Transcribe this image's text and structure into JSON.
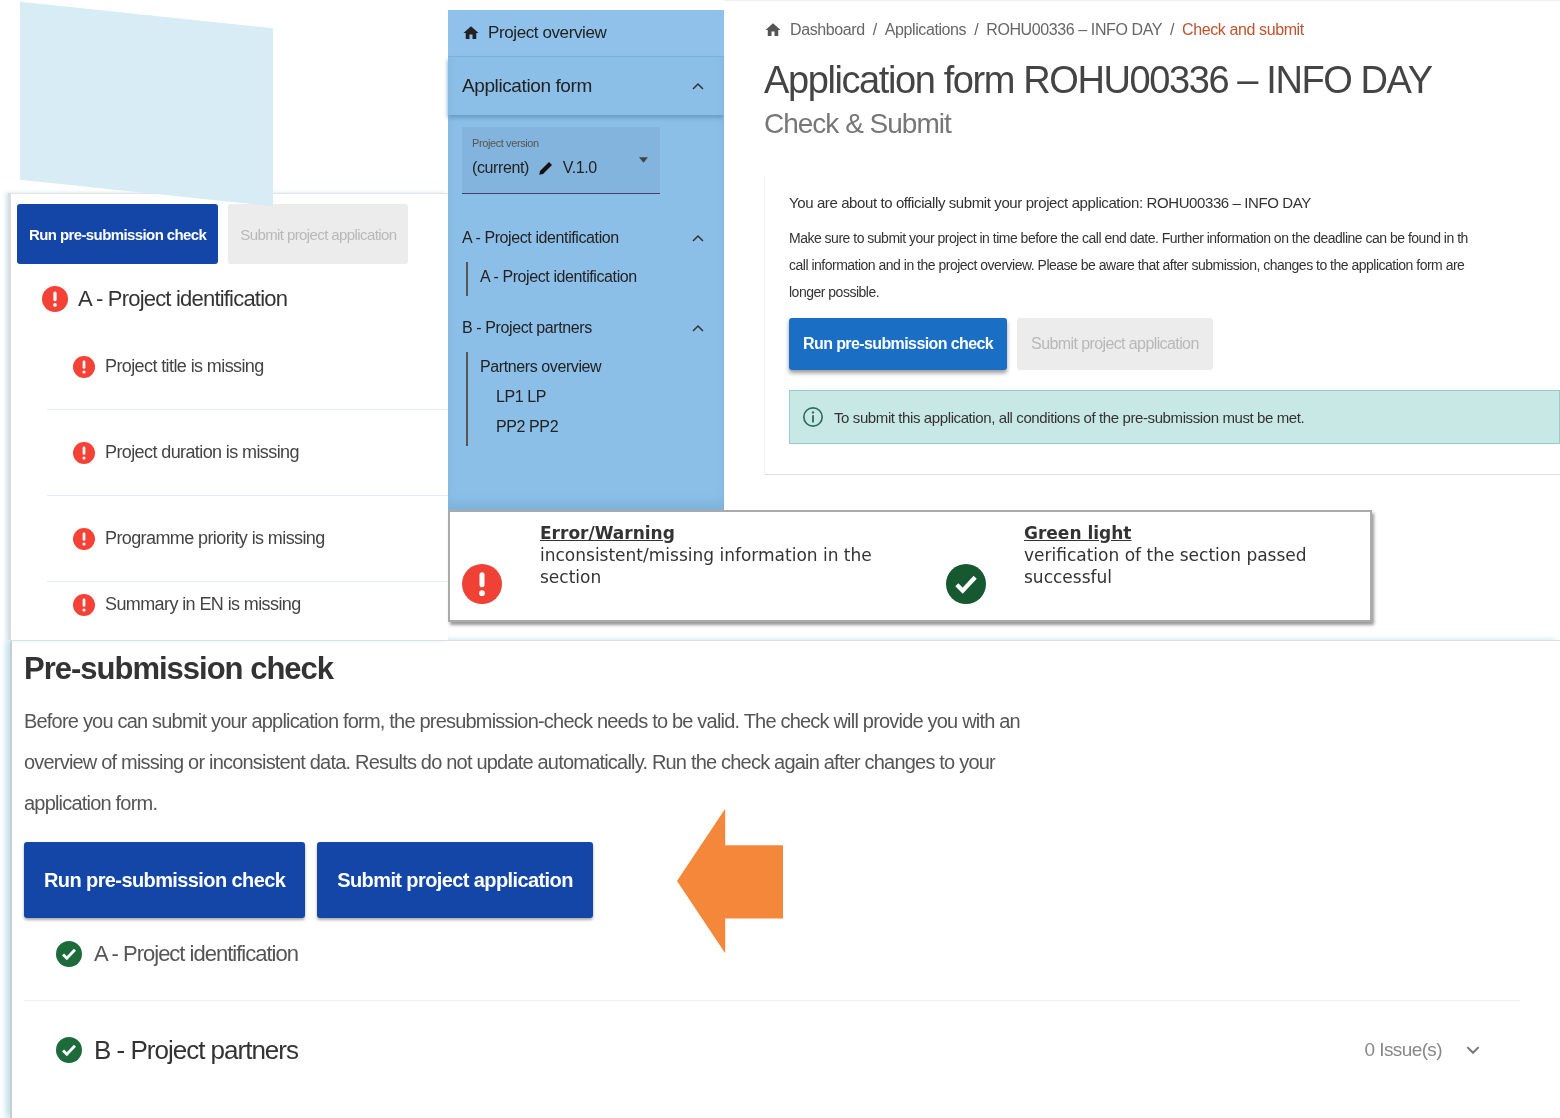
{
  "check_panel": {
    "buttons": [
      {
        "label": "Run pre-submission check",
        "enabled": true
      },
      {
        "label": "Submit project application",
        "enabled": false
      }
    ],
    "section": {
      "title": "A - Project identification",
      "kind": "error"
    },
    "issues": [
      {
        "text": "Project title is missing",
        "kind": "error"
      },
      {
        "text": "Project duration is missing",
        "kind": "error"
      },
      {
        "text": "Programme priority is missing",
        "kind": "error"
      },
      {
        "text": "Summary in EN is missing",
        "kind": "error"
      }
    ]
  },
  "sidebar": {
    "header": "Project overview",
    "application_form": {
      "label": "Application form",
      "expanded": true
    },
    "version": {
      "label": "Project version",
      "prefix": "(current)",
      "value": "V.1.0"
    },
    "groups": [
      {
        "label": "A - Project identification",
        "expanded": true,
        "children": [
          {
            "label": "A - Project identification"
          }
        ]
      },
      {
        "label": "B - Project partners",
        "expanded": true,
        "children": [
          {
            "label": "Partners overview",
            "children": [
              {
                "label": "LP1 LP"
              },
              {
                "label": "PP2 PP2"
              }
            ]
          }
        ]
      }
    ]
  },
  "main": {
    "breadcrumb": [
      {
        "label": "Dashboard",
        "current": false
      },
      {
        "label": "Applications",
        "current": false
      },
      {
        "label": "ROHU00336 – INFO DAY",
        "current": false
      },
      {
        "label": "Check and submit",
        "current": true
      }
    ],
    "separator": "/",
    "title": "Application form ROHU00336 – INFO DAY",
    "subtitle": "Check & Submit",
    "intro": "You are about to officially submit your project application: ROHU00336 – INFO DAY",
    "lines": [
      "Make sure to submit your project in time before the call end date. Further information on the deadline can be found in th",
      "call information and in the project overview. Please be aware that after submission, changes to the application form are",
      "longer possible."
    ],
    "buttons": [
      {
        "label": "Run pre-submission check",
        "enabled": true
      },
      {
        "label": "Submit project application",
        "enabled": false
      }
    ],
    "alert": "To submit this application, all conditions of the pre-submission must be met."
  },
  "legend": [
    {
      "kind": "error",
      "title": "Error/Warning",
      "text": "inconsistent/missing information in the section"
    },
    {
      "kind": "ok",
      "title": "Green light",
      "text": "verification of the section passed successful"
    }
  ],
  "presubmission": {
    "title": "Pre-submission check",
    "text": "Before you can submit your application form, the presubmission-check needs to be valid. The check will provide you with an overview of missing or inconsistent data. Results do not update automatically. Run the check again after changes to your application form.",
    "buttons": [
      {
        "label": "Run pre-submission check",
        "enabled": true
      },
      {
        "label": "Submit project application",
        "enabled": true
      }
    ],
    "sections": [
      {
        "title": "A - Project identification",
        "kind": "ok"
      },
      {
        "title": "B - Project partners",
        "kind": "ok",
        "issues": "0 Issue(s)"
      }
    ]
  }
}
